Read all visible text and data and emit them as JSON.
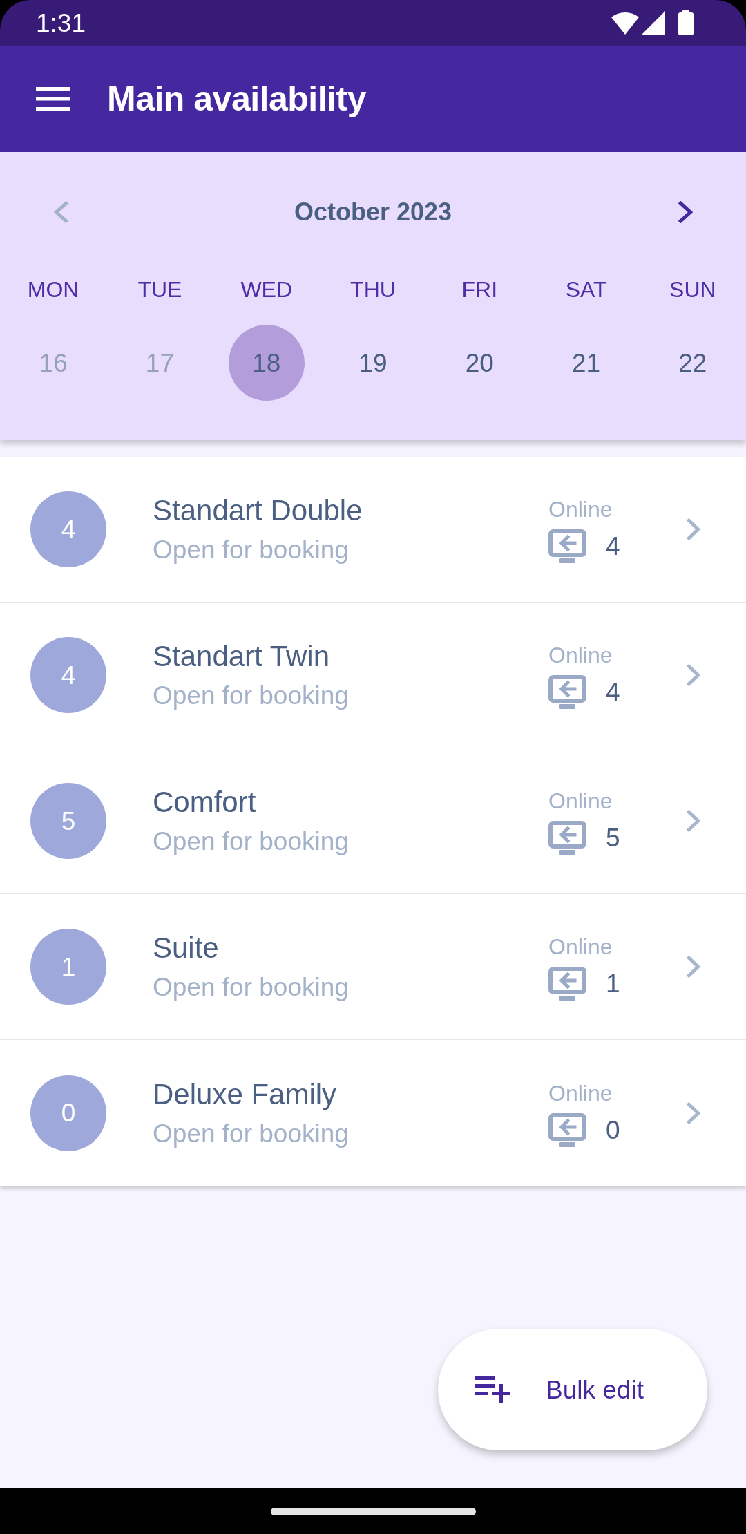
{
  "status_bar": {
    "time": "1:31"
  },
  "app_bar": {
    "title": "Main availability"
  },
  "calendar": {
    "month": "October 2023",
    "prev": {
      "disabled": true
    },
    "next": {
      "disabled": false
    },
    "weekdays": [
      "MON",
      "TUE",
      "WED",
      "THU",
      "FRI",
      "SAT",
      "SUN"
    ],
    "days": [
      {
        "day": "16",
        "disabled": true,
        "selected": false
      },
      {
        "day": "17",
        "disabled": true,
        "selected": false
      },
      {
        "day": "18",
        "disabled": false,
        "selected": true
      },
      {
        "day": "19",
        "disabled": false,
        "selected": false
      },
      {
        "day": "20",
        "disabled": false,
        "selected": false
      },
      {
        "day": "21",
        "disabled": false,
        "selected": false
      },
      {
        "day": "22",
        "disabled": false,
        "selected": false
      }
    ]
  },
  "room_types": [
    {
      "count": "4",
      "name": "Standart Double",
      "status": "Open for booking",
      "channel": "Online",
      "online_count": "4"
    },
    {
      "count": "4",
      "name": "Standart Twin",
      "status": "Open for booking",
      "channel": "Online",
      "online_count": "4"
    },
    {
      "count": "5",
      "name": "Comfort",
      "status": "Open for booking",
      "channel": "Online",
      "online_count": "5"
    },
    {
      "count": "1",
      "name": "Suite",
      "status": "Open for booking",
      "channel": "Online",
      "online_count": "1"
    },
    {
      "count": "0",
      "name": "Deluxe Family",
      "status": "Open for booking",
      "channel": "Online",
      "online_count": "0"
    }
  ],
  "fab": {
    "label": "Bulk edit"
  }
}
